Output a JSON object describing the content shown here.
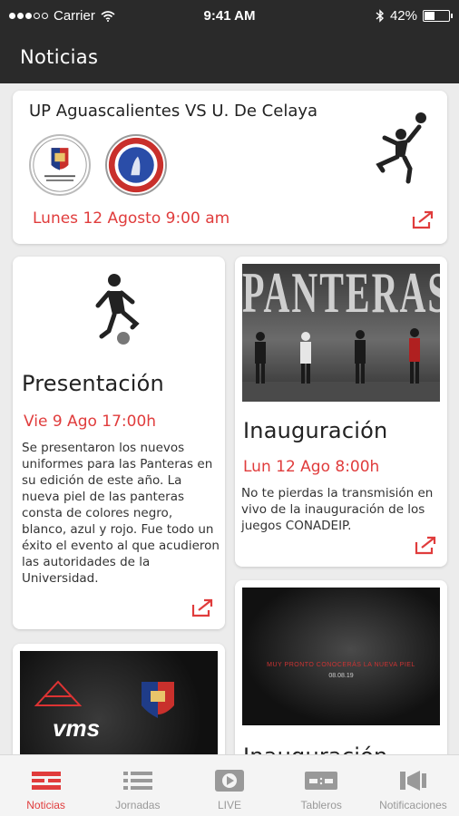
{
  "status_bar": {
    "carrier": "Carrier",
    "time": "9:41 AM",
    "battery": "42%"
  },
  "app_bar": {
    "title": "Noticias"
  },
  "match": {
    "title": "UP Aguascalientes VS U. De Celaya",
    "date": "Lunes 12 Agosto 9:00 am"
  },
  "cards": [
    {
      "title": "Presentación",
      "date": "Vie 9 Ago 17:00h",
      "text": "Se presentaron los nuevos uniformes para las Panteras en su edición de este año. La nueva piel de las panteras consta de colores negro, blanco, azul y rojo. Fue todo un éxito el evento al que acudieron las autoridades de la Universidad."
    },
    {
      "title": "Inauguración",
      "date": "Lun 12 Ago 8:00h",
      "text": "No te pierdas la transmisión en vivo de la inauguración de los juegos CONADEIP.",
      "photo_text": "PANTERAS"
    },
    {
      "photo_text": "MUY PRONTO CONOCERÁS LA NUEVA PIEL",
      "photo_date": "08.08.19",
      "title": "Inauguración"
    },
    {
      "photo_text": "vms"
    }
  ],
  "tabs": [
    {
      "label": "Noticias",
      "icon": "news-icon",
      "active": true
    },
    {
      "label": "Jornadas",
      "icon": "list-icon",
      "active": false
    },
    {
      "label": "LIVE",
      "icon": "play-icon",
      "active": false
    },
    {
      "label": "Tableros",
      "icon": "scoreboard-icon",
      "active": false
    },
    {
      "label": "Notificaciones",
      "icon": "megaphone-icon",
      "active": false
    }
  ],
  "colors": {
    "accent": "#e03c3c",
    "bar": "#2a2a2a",
    "background": "#ececec"
  }
}
